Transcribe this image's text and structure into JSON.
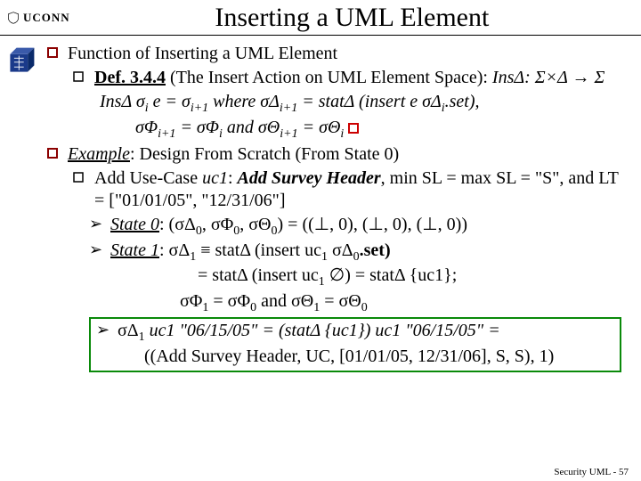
{
  "header": {
    "logo_text": "UCONN",
    "title": "Inserting a UML Element"
  },
  "bullets": {
    "b1": "Function of Inserting a UML Element",
    "b1_def_label": "Def. 3.4.4",
    "b1_def_text": " (The Insert Action on UML Element Space): ",
    "b1_def_formula": "InsΔ: Σ×Δ → Σ",
    "ins_line1_a": "InsΔ σ",
    "ins_line1_b": " e = σ",
    "ins_line1_c": " where σΔ",
    "ins_line1_d": " = statΔ (insert e σΔ",
    "ins_line1_e": ".set),",
    "ins_line2_a": "σΦ",
    "ins_line2_b": " = σΦ",
    "ins_line2_c": " and σΘ",
    "ins_line2_d": " = σΘ",
    "i": "i",
    "ip1": "i+1",
    "b2": "Example",
    "b2_rest": ": Design From Scratch (From State 0)",
    "b2_sub1": "Add Use-Case ",
    "uc1": "uc1",
    "b2_sub1b": ": ",
    "addsh": "Add Survey Header",
    "b2_sub1c": ", min SL = max SL = \"S\", and LT = [\"01/01/05\", \"12/31/06\"]",
    "state0_label": "State 0",
    "state0_rest": ": (σΔ",
    "state0_rest2": ", σΦ",
    "state0_rest3": ", σΘ",
    "state0_rest4": ") = ((⊥, 0), (⊥, 0), (⊥, 0))",
    "zero": "0",
    "state1_label": "State 1",
    "state1_rest": ": σΔ",
    "one": "1",
    "state1_rest2": " ≡ statΔ (insert uc",
    "state1_rest3": " σΔ",
    "state1_rest4": ".set)",
    "eq_line1": "= statΔ (insert uc",
    "eq_line1b": " ∅) = statΔ {uc1};",
    "eq_line2a": "σΦ",
    "eq_line2b": " = σΦ",
    "eq_line2c": " and σΘ",
    "eq_line2d": " = σΘ",
    "boxed_a": "σΔ",
    "boxed_b": " uc1 \"06/15/05\" = (statΔ {uc1}) uc1 \"06/15/05\" =",
    "boxed_c": "((Add Survey Header, UC, [01/01/05, 12/31/06], S, S), 1)"
  },
  "footer": "Security UML - 57"
}
